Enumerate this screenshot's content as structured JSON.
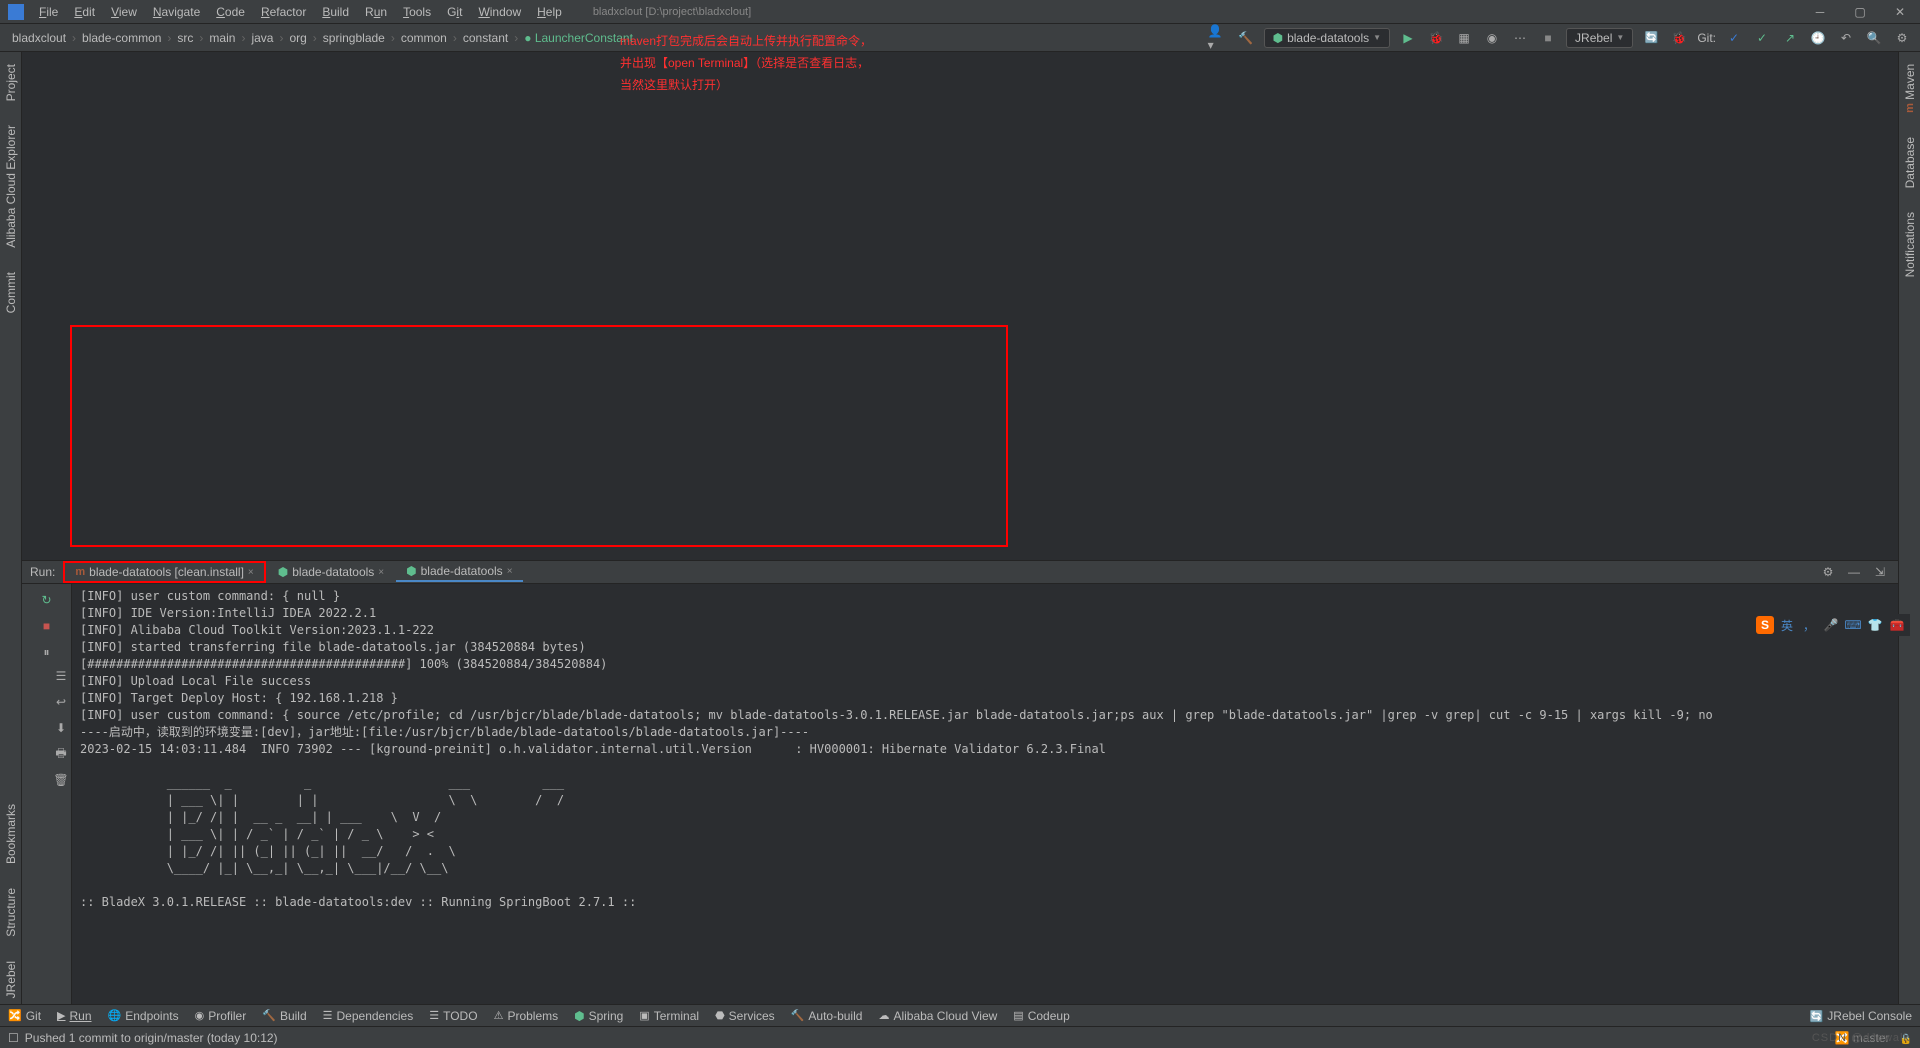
{
  "window": {
    "title": "bladxclout [D:\\project\\bladxclout]"
  },
  "menu": [
    "File",
    "Edit",
    "View",
    "Navigate",
    "Code",
    "Refactor",
    "Build",
    "Run",
    "Tools",
    "Git",
    "Window",
    "Help"
  ],
  "breadcrumbs": [
    "bladxclout",
    "blade-common",
    "src",
    "main",
    "java",
    "org",
    "springblade",
    "common",
    "constant"
  ],
  "breadcrumb_last": "LauncherConstant",
  "toolbar": {
    "run_config": "blade-datatools",
    "jrebel": "JRebel",
    "git_label": "Git:"
  },
  "left_tabs": [
    "Project",
    "Alibaba Cloud Explorer",
    "Commit",
    "Bookmarks",
    "Structure",
    "JRebel"
  ],
  "right_tabs": [
    "Maven",
    "Database",
    "Notifications"
  ],
  "run": {
    "label": "Run:",
    "tabs": [
      {
        "label": "blade-datatools [clean.install]",
        "highlighted": true,
        "icon": "m"
      },
      {
        "label": "blade-datatools",
        "icon": "spring"
      },
      {
        "label": "blade-datatools",
        "active": true,
        "icon": "spring"
      }
    ]
  },
  "console_lines": [
    "[INFO] user custom command: { null }",
    "[INFO] IDE Version:IntelliJ IDEA 2022.2.1",
    "[INFO] Alibaba Cloud Toolkit Version:2023.1.1-222",
    "[INFO] started transferring file blade-datatools.jar (384520884 bytes)",
    "[############################################] 100% (384520884/384520884)",
    "[INFO] Upload Local File success",
    "[INFO] Target Deploy Host: { 192.168.1.218 }",
    "[INFO] user custom command: { source /etc/profile; cd /usr/bjcr/blade/blade-datatools; mv blade-datatools-3.0.1.RELEASE.jar blade-datatools.jar;ps aux | grep \"blade-datatools.jar\" |grep -v grep| cut -c 9-15 | xargs kill -9; no",
    "----启动中，读取到的环境变量:[dev]，jar地址:[file:/usr/bjcr/blade/blade-datatools/blade-datatools.jar]----",
    "2023-02-15 14:03:11.484  INFO 73902 --- [kground-preinit] o.h.validator.internal.util.Version      : HV000001: Hibernate Validator 6.2.3.Final",
    "",
    "            ______  _          _                   ___          ___ ",
    "            | ___ \\| |        | |                  \\  \\        /  / ",
    "            | |_/ /| |  __ _  __| | ___    \\  V  / ",
    "            | ___ \\| | / _` | / _` | / _ \\    > <  ",
    "            | |_/ /| || (_| || (_| ||  __/   /  .  \\ ",
    "            \\____/ |_| \\__,_| \\__,_| \\___|/__/ \\__\\ ",
    "",
    ":: BladeX 3.0.1.RELEASE :: blade-datatools:dev :: Running SpringBoot 2.7.1 ::"
  ],
  "annotation": {
    "l1": "maven打包完成后会自动上传并执行配置命令，",
    "l2": "并出现【open Terminal】（选择是否查看日志，",
    "l3": "当然这里默认打开）"
  },
  "tool_windows": [
    "Git",
    "Run",
    "Endpoints",
    "Profiler",
    "Build",
    "Dependencies",
    "TODO",
    "Problems",
    "Spring",
    "Terminal",
    "Services",
    "Auto-build",
    "Alibaba Cloud View",
    "Codeup"
  ],
  "jrebel_console": "JRebel Console",
  "status": {
    "msg": "Pushed 1 commit to origin/master (today 10:12)",
    "branch": "master",
    "watermark": "CSDN @dJowalk"
  },
  "ime": {
    "s": "S",
    "lang": "英"
  }
}
